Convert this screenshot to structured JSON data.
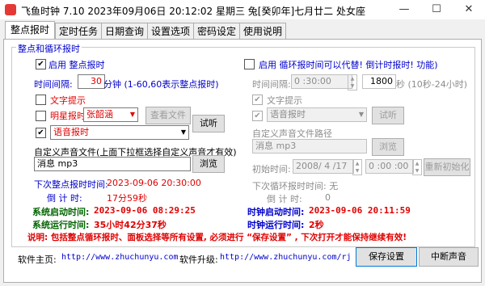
{
  "window": {
    "title": "飞鱼时钟 7.10 2023年09月06日 20:12:02 星期三 兔[癸卯年]七月廿二 处女座",
    "minimize_glyph": "—",
    "maximize_glyph": "☐",
    "close_glyph": "✕"
  },
  "tabs": [
    "整点报时",
    "定时任务",
    "日期查询",
    "设置选项",
    "密码设定",
    "使用说明"
  ],
  "group_title": "整点和循环报时",
  "left": {
    "enable_check": "✔",
    "enable_label": "启用 整点报时",
    "interval_label": "时间间隔:",
    "interval_value": "30",
    "interval_unit": "分钟 (1-60,60表示整点报时)",
    "text_hint_label": "文字提示",
    "star_check": "",
    "star_label": "明星报时",
    "star_select": "张韶涵",
    "view_file_btn": "查看文件",
    "voice_check": "✔",
    "voice_select": "语音报时",
    "test_btn": "试听",
    "custom_label": "自定义声音文件(上面下拉框选择自定义声音才有效)",
    "custom_value": "消息 mp3",
    "browse_btn": "浏览",
    "next_label": "下次整点报时时间:",
    "next_value": "2023-09-06 20:30:00",
    "countdown_label": "倒 计 时:",
    "countdown_value": "17分59秒"
  },
  "right": {
    "enable_label": "启用 循环报时间可以代替! 倒计时报时! 功能)",
    "interval_label": "时间间隔:",
    "interval_value": "0 :30:00",
    "seconds_value": "1800",
    "seconds_unit": "秒  (10秒-24小时)",
    "text_check": "✔",
    "text_hint_label": "文字提示",
    "voice_check": "✔",
    "voice_select": "语音报时",
    "test_btn": "试听",
    "custom_label": "自定义声音文件路径",
    "custom_value": "消息 mp3",
    "browse_btn": "浏览",
    "init_label": "初始时间:",
    "init_date": "2008/ 4 /17",
    "init_time": "0 :00 :00",
    "reinit_btn": "重新初始化",
    "next_label": "下次循环报时时间: 无",
    "countdown_label": "倒 计 时:",
    "countdown_value": "0"
  },
  "status": {
    "sys_start_label": "系统启动时间:",
    "sys_start_value": "2023-09-06 08:29:25",
    "sys_run_label": "系统运行时间:",
    "sys_run_value": "35小时42分37秒",
    "clock_start_label": "时钟启动时间:",
    "clock_start_value": "2023-09-06 20:11:59",
    "clock_run_label": "时钟运行时间:",
    "clock_run_value": "2秒"
  },
  "note": "说明: 包括整点循环报时、面板选择等所有设置, 必须进行 “保存设置” , 下次打开才能保持继续有效!",
  "footer": {
    "homepage_label": "软件主页:",
    "homepage_url": "http://www.zhuchunyu.com",
    "upgrade_label": "软件升级:",
    "upgrade_url": "http://www.zhuchunyu.com/rj",
    "save_btn": "保存设置",
    "stop_btn": "中断声音"
  },
  "colors": {
    "accent_blue": "#0000cc",
    "alert_red": "#e00000",
    "primary_button_border": "#0078d7"
  }
}
